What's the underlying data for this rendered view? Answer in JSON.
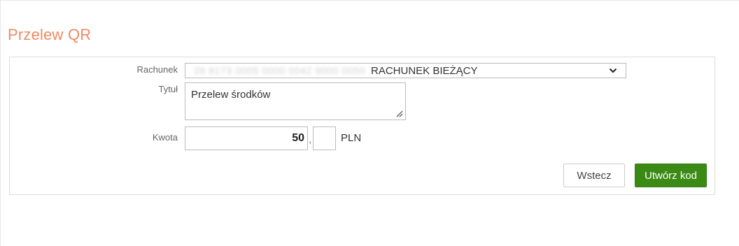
{
  "page": {
    "title": "Przelew QR"
  },
  "form": {
    "account": {
      "label": "Rachunek",
      "number_masked": "26 8173 0005 0000 0042 9000 0050",
      "name": "RACHUNEK BIEŻĄCY",
      "icon": "chevron-down-icon"
    },
    "title_field": {
      "label": "Tytuł",
      "value": "Przelew środków"
    },
    "amount": {
      "label": "Kwota",
      "whole_value": "50",
      "separator": ",",
      "cents_value": "",
      "currency": "PLN"
    }
  },
  "actions": {
    "back_label": "Wstecz",
    "create_label": "Utwórz kod"
  },
  "colors": {
    "title_accent": "#ee8a62",
    "primary_button": "#3b8a16"
  }
}
